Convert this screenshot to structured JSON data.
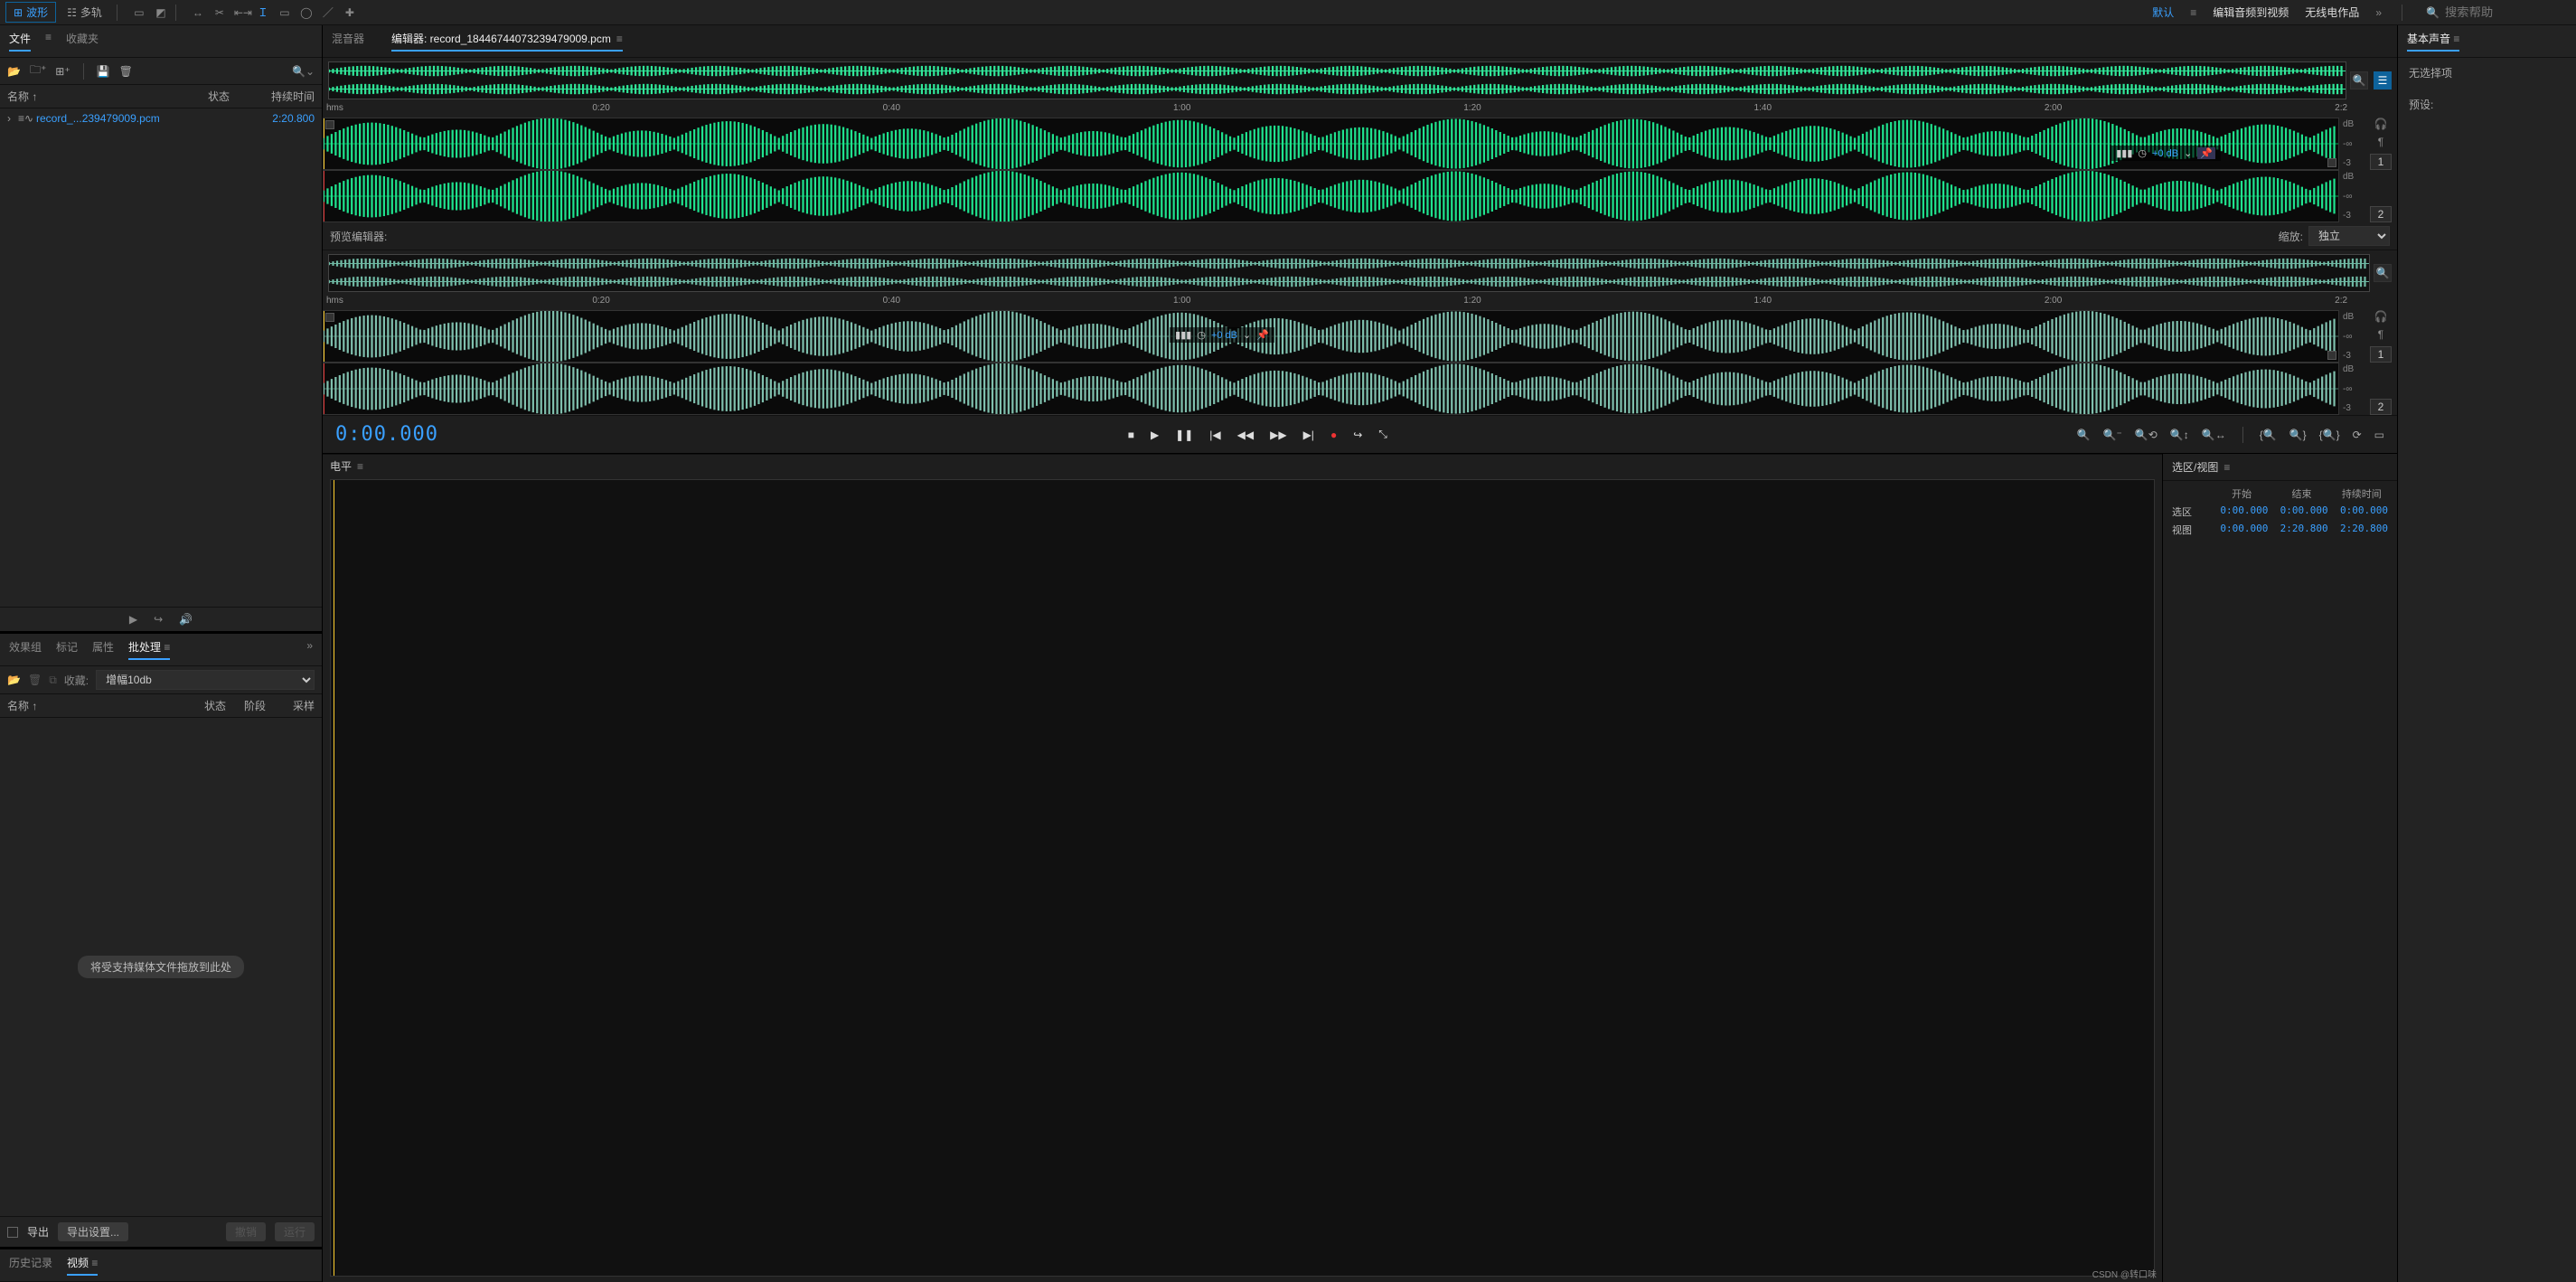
{
  "topbar": {
    "waveform": "波形",
    "multitrack": "多轨",
    "workspaces": {
      "default": "默认",
      "edit_to_video": "编辑音频到视频",
      "radio": "无线电作品"
    },
    "search_placeholder": "搜索帮助"
  },
  "files_panel": {
    "tabs": {
      "files": "文件",
      "favorites": "收藏夹"
    },
    "columns": {
      "name": "名称 ↑",
      "status": "状态",
      "duration": "持续时间"
    },
    "items": [
      {
        "name": "record_...239479009.pcm",
        "duration": "2:20.800"
      }
    ]
  },
  "fx_panel": {
    "tabs": {
      "fx": "效果组",
      "marker": "标记",
      "prop": "属性",
      "batch": "批处理"
    },
    "fav_label": "收藏:",
    "fav_value": "增幅10db",
    "columns": {
      "name": "名称 ↑",
      "status": "状态",
      "phase": "阶段",
      "sample": "采样"
    },
    "drop_hint": "将受支持媒体文件拖放到此处",
    "export": "导出",
    "export_settings": "导出设置...",
    "undo": "撤销",
    "run": "运行"
  },
  "history_panel": {
    "history": "历史记录",
    "video": "视频"
  },
  "editor": {
    "mixer_tab": "混音器",
    "editor_tab": "编辑器: record_18446744073239479009.pcm",
    "ruler_unit": "hms",
    "ticks": [
      "0:20",
      "0:40",
      "1:00",
      "1:20",
      "1:40",
      "2:00",
      "2:2"
    ],
    "db_labels": {
      "top": "dB",
      "mid": "-∞",
      "bot": "-3"
    },
    "channels": [
      "1",
      "2"
    ],
    "hud_db": "+0 dB",
    "preview": {
      "label": "预览编辑器:",
      "zoom_label": "缩放:",
      "zoom_value": "独立",
      "hud_db": "+0 dB"
    }
  },
  "transport": {
    "time": "0:00.000"
  },
  "levels": {
    "title": "电平"
  },
  "essential_sound": {
    "title": "基本声音",
    "no_selection": "无选择项",
    "preset": "预设:"
  },
  "selection_view": {
    "title": "选区/视图",
    "headers": {
      "start": "开始",
      "end": "结束",
      "duration": "持续时间"
    },
    "rows": [
      {
        "label": "选区",
        "start": "0:00.000",
        "end": "0:00.000",
        "dur": "0:00.000"
      },
      {
        "label": "视图",
        "start": "0:00.000",
        "end": "2:20.800",
        "dur": "2:20.800"
      }
    ]
  },
  "watermark": "CSDN @转口味"
}
